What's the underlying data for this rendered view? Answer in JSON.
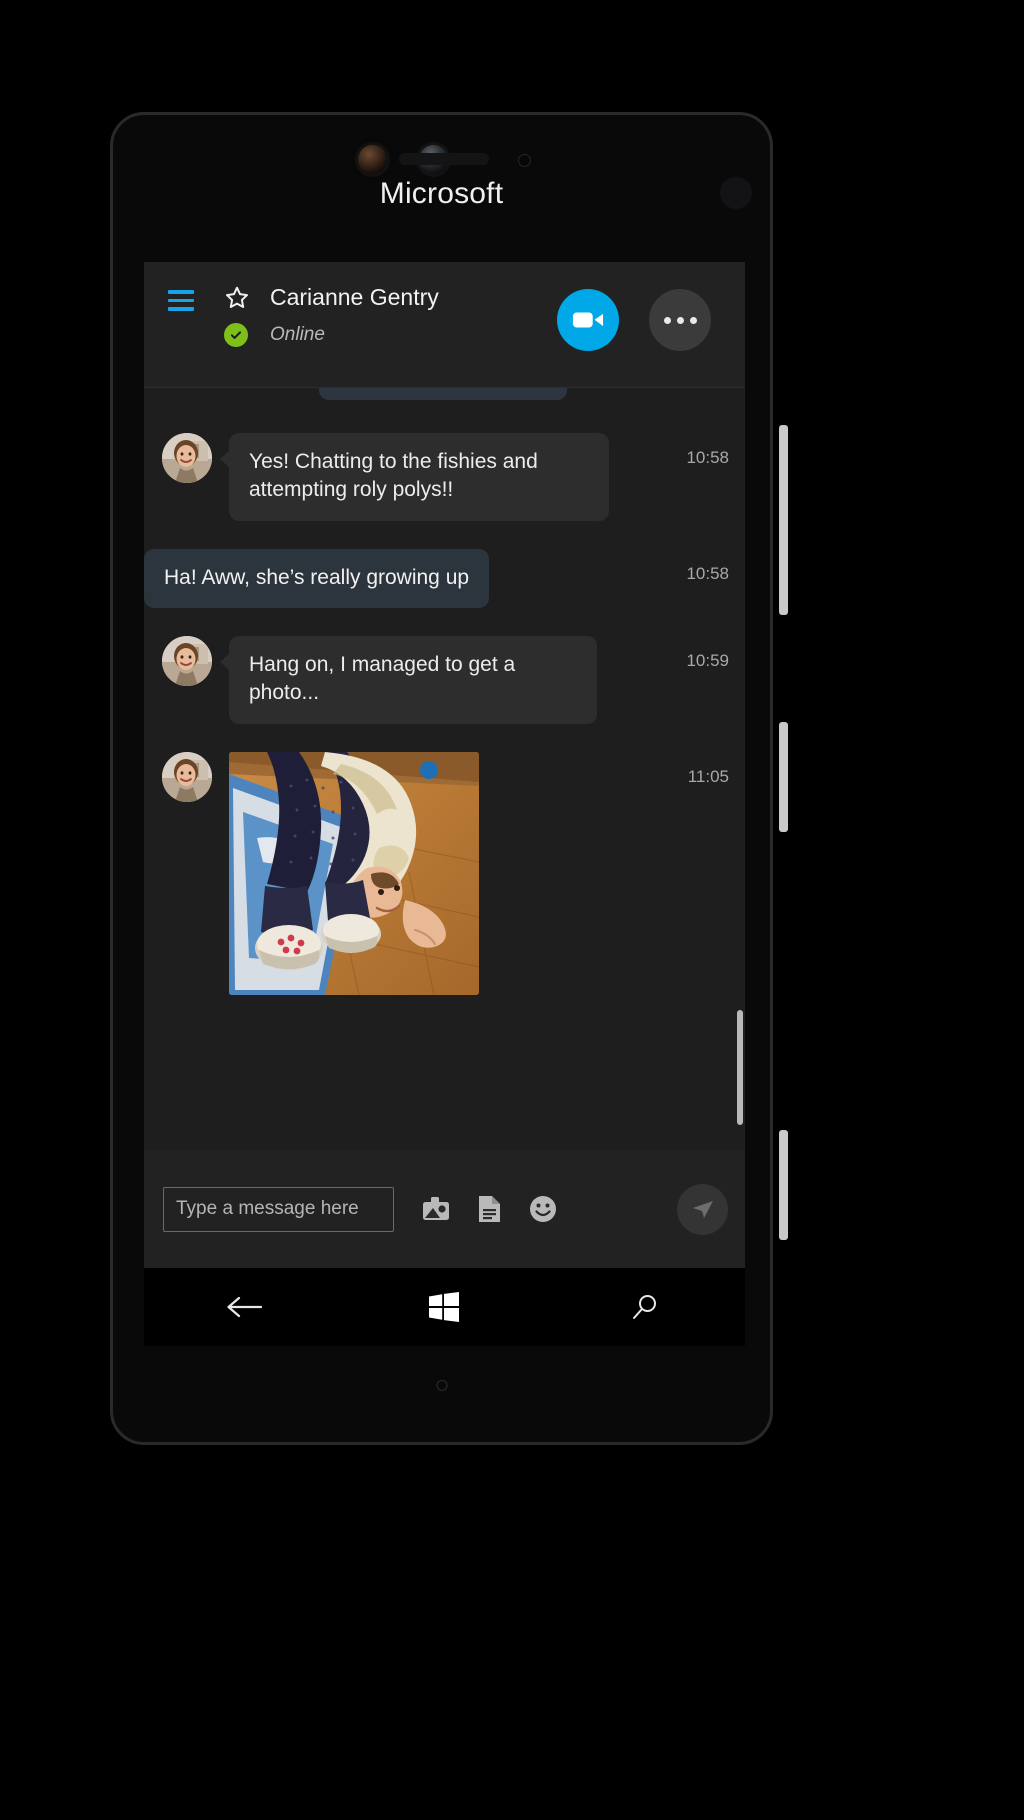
{
  "device": {
    "brand": "Microsoft",
    "front_camera_icon": "camera-icon",
    "proximity_sensor_icon": "sensor-icon",
    "earpiece_icon": "speaker-icon"
  },
  "app_header": {
    "menu_icon": "hamburger-menu-icon",
    "favorite_icon": "star-icon",
    "contact_name": "Carianne Gentry",
    "presence_status": "Online",
    "presence_color": "#7fbf1a",
    "video_call_icon": "video-camera-icon",
    "video_call_color": "#00a8e8",
    "more_options_icon": "ellipsis-icon"
  },
  "conversation": {
    "messages": [
      {
        "id": "msg-1",
        "direction": "incoming",
        "text": "Yes! Chatting to the fishies and attempting roly polys!!",
        "time": "10:58",
        "type": "text",
        "avatar_icon": "contact-avatar"
      },
      {
        "id": "msg-2",
        "direction": "outgoing",
        "text": "Ha! Aww, she’s really growing up",
        "time": "10:58",
        "type": "text"
      },
      {
        "id": "msg-3",
        "direction": "incoming",
        "text": "Hang on, I managed to get a photo...",
        "time": "10:59",
        "type": "text",
        "avatar_icon": "contact-avatar"
      },
      {
        "id": "msg-4",
        "direction": "incoming",
        "text": "",
        "time": "11:05",
        "type": "photo",
        "photo_description": "toddler-photo",
        "avatar_icon": "contact-avatar"
      }
    ]
  },
  "composer": {
    "input_value": "",
    "input_placeholder": "Type a message here",
    "image_icon": "image-attachment-icon",
    "file_icon": "file-attachment-icon",
    "emoji_icon": "emoji-smiley-icon",
    "send_icon": "send-paper-plane-icon"
  },
  "navbar": {
    "back_icon": "back-arrow-icon",
    "home_icon": "windows-logo-icon",
    "search_icon": "search-magnifier-icon"
  },
  "colors": {
    "accent": "#00a8e8",
    "menu_accent": "#18a4e8",
    "presence_online": "#7fbf1a",
    "incoming_bubble": "#2d2d2d",
    "outgoing_bubble": "#2c343d",
    "app_background": "#1e1e1e",
    "header_background": "#222222"
  }
}
